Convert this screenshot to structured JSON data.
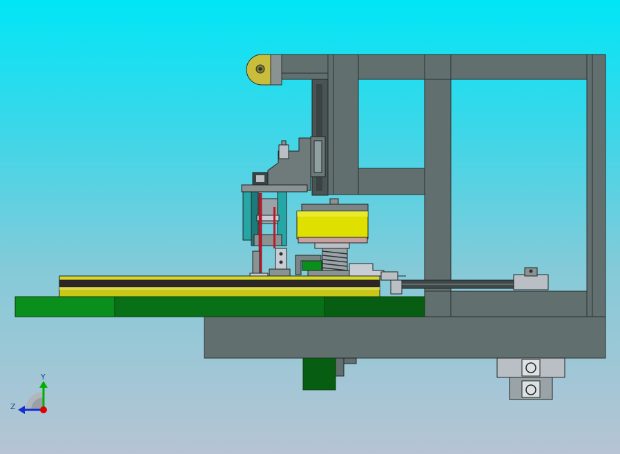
{
  "viewport": {
    "background_top": "#00e6f6",
    "background_bottom": "#b6c4d4"
  },
  "colors": {
    "frame": "#626f6f",
    "frame_dark": "#3f4848",
    "frame_edge": "#2a3030",
    "base_green": "#0b8f1c",
    "base_green_dark": "#075e12",
    "disc_yellow": "#d6d82a",
    "motor_yellow": "#e0e000",
    "accent_teal": "#27a6a6",
    "accent_red": "#c0182a",
    "light_steel": "#b9bfc4"
  },
  "triad": {
    "y_label": "Y",
    "z_label": "Z",
    "x_axis_color": "#e00000",
    "y_axis_color": "#00b000",
    "z_axis_color": "#1030d0"
  }
}
